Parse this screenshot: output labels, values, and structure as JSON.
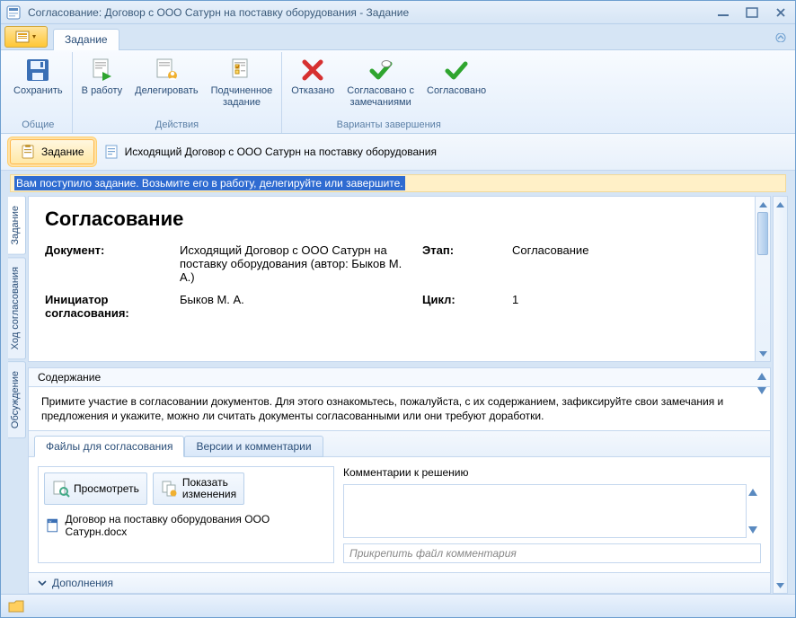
{
  "window": {
    "title": "Согласование: Договор с ООО Сатурн на поставку оборудования - Задание"
  },
  "ribbonTab": "Задание",
  "groups": {
    "common": {
      "label": "Общие",
      "save": "Сохранить"
    },
    "actions": {
      "label": "Действия",
      "start": "В работу",
      "delegate": "Делегировать",
      "subtask": "Подчиненное\nзадание"
    },
    "complete": {
      "label": "Варианты завершения",
      "reject": "Отказано",
      "agree_remarks": "Согласовано с\nзамечаниями",
      "agree": "Согласовано"
    }
  },
  "strip": {
    "task": "Задание",
    "doc": "Исходящий Договор с ООО Сатурн на поставку оборудования"
  },
  "hint": "Вам поступило задание. Возьмите его в работу, делегируйте или завершите.",
  "form": {
    "heading": "Согласование",
    "doc_label": "Документ:",
    "doc_val": "Исходящий Договор с ООО Сатурн на поставку оборудования (автор: Быков М. А.)",
    "stage_label": "Этап:",
    "stage_val": "Согласование",
    "init_label": "Инициатор согласования:",
    "init_val": "Быков М. А.",
    "cycle_label": "Цикл:",
    "cycle_val": "1"
  },
  "sidetabs": {
    "t1": "Задание",
    "t2": "Ход согласования",
    "t3": "Обсуждение"
  },
  "content": {
    "head": "Содержание",
    "body": "Примите участие в согласовании документов. Для этого ознакомьтесь, пожалуйста, с их содержанием, зафиксируйте свои замечания и предложения и укажите, можно ли считать документы согласованными или они требуют доработки."
  },
  "tabs2": {
    "files": "Файлы для согласования",
    "versions": "Версии и комментарии"
  },
  "files": {
    "view": "Просмотреть",
    "diff": "Показать\nизменения",
    "item": "Договор на поставку оборудования ООО Сатурн.docx"
  },
  "comments": {
    "label": "Комментарии к решению",
    "attach_ph": "Прикрепить файл комментария"
  },
  "expand": "Дополнения"
}
